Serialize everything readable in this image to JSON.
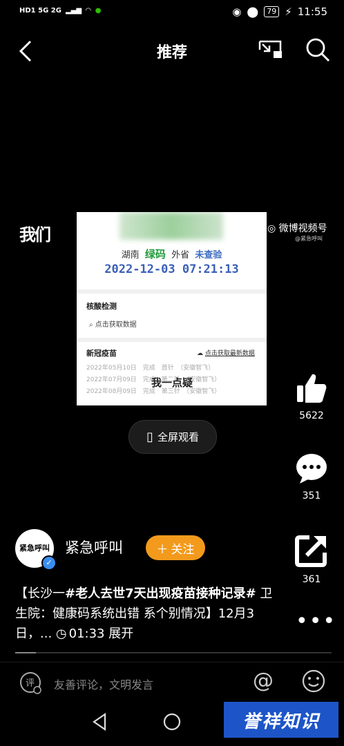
{
  "status_bar": {
    "left": "HD1 5G 2G",
    "battery": "79",
    "time": "11:55"
  },
  "header": {
    "title": "推荐"
  },
  "video": {
    "province": "湖南",
    "code_label": "绿码",
    "outside": "外省",
    "unchecked": "未查验",
    "datetime": "2022-12-03 07:21:13",
    "nucleic_title": "核酸检测",
    "fetch_data": "点击获取数据",
    "vaccine_title": "新冠疫苗",
    "fetch_latest": "点击获取最新数据",
    "records": [
      "2022年05月10日　完成　首针　（安徽智飞）",
      "2022年07月09日　完成　第二针　（安徽智飞）",
      "2022年08月09日　完成　第三针　（安徽智飞）"
    ],
    "overlay_text": "我一点疑",
    "watermark_left": "我们",
    "watermark_right": "微博视频号",
    "watermark_right_sub": "@紧急呼叫"
  },
  "fullscreen_label": "全屏观看",
  "rail": {
    "likes": "5622",
    "comments": "351",
    "shares": "361"
  },
  "author": {
    "avatar_text": "紧急呼叫",
    "name": "紧急呼叫",
    "follow_label": "关注"
  },
  "caption": {
    "part1": "【长沙一",
    "hashtag": "#老人去世7天出现疫苗接种记录#",
    "part2": " 卫生院：健康码系统出错 系个别情况】12月3日，...",
    "duration": "01:33",
    "expand": "展开"
  },
  "comment_bar": {
    "placeholder": "友善评论，文明发言"
  },
  "brand": "誉祥知识"
}
